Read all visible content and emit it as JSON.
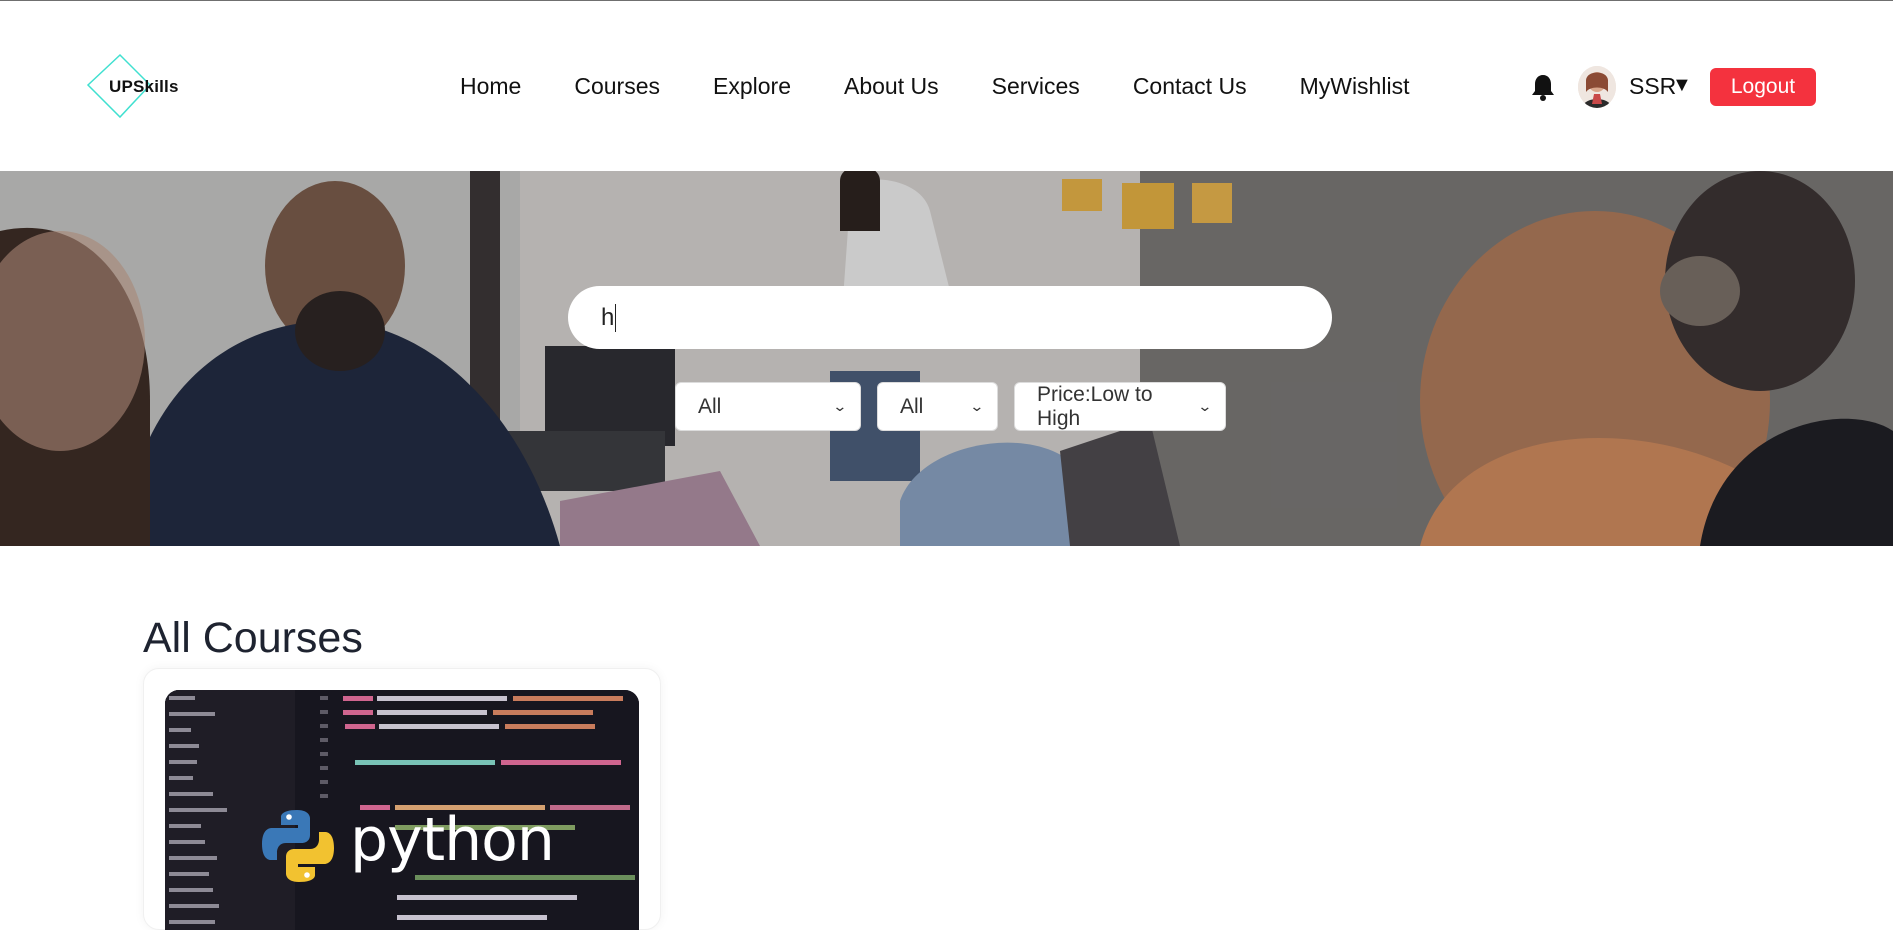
{
  "brand": {
    "name": "UPSkills",
    "accent": "#40e0d0"
  },
  "nav": {
    "items": [
      {
        "label": "Home"
      },
      {
        "label": "Courses"
      },
      {
        "label": "Explore"
      },
      {
        "label": "About Us"
      },
      {
        "label": "Services"
      },
      {
        "label": "Contact Us"
      },
      {
        "label": "MyWishlist"
      }
    ]
  },
  "user": {
    "name": "SSR",
    "caret": "▼",
    "logout_label": "Logout",
    "logout_color": "#f4323e"
  },
  "search": {
    "value": "h"
  },
  "filters": [
    {
      "selected": "All"
    },
    {
      "selected": "All"
    },
    {
      "selected": "Price:Low to High"
    }
  ],
  "main": {
    "title": "All Courses",
    "courses": [
      {
        "thumbnail_text": "python"
      }
    ]
  },
  "icons": {
    "notification": "bell-icon",
    "avatar": "user-avatar",
    "select_arrow": "chevron-down-icon",
    "course_logo": "python-logo-icon"
  }
}
